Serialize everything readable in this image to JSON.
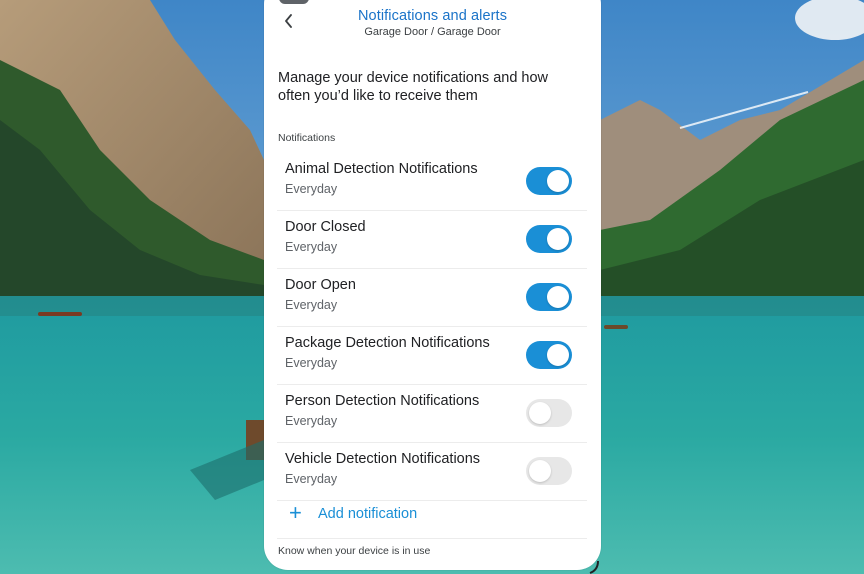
{
  "header": {
    "title": "Notifications and alerts",
    "subtitle": "Garage Door / Garage Door",
    "back_icon": "chevron-left-icon"
  },
  "intro": "Manage your device notifications and how often you’d like to receive them",
  "section_label": "Notifications",
  "notifications": [
    {
      "title": "Animal Detection Notifications",
      "frequency": "Everyday",
      "enabled": true
    },
    {
      "title": "Door Closed",
      "frequency": "Everyday",
      "enabled": true
    },
    {
      "title": "Door Open",
      "frequency": "Everyday",
      "enabled": true
    },
    {
      "title": "Package Detection Notifications",
      "frequency": "Everyday",
      "enabled": true
    },
    {
      "title": "Person Detection Notifications",
      "frequency": "Everyday",
      "enabled": false
    },
    {
      "title": "Vehicle Detection Notifications",
      "frequency": "Everyday",
      "enabled": false
    }
  ],
  "add_notification": {
    "label": "Add notification",
    "icon": "plus-icon"
  },
  "footer_note": "Know when your device is in use",
  "colors": {
    "accent": "#1a8fd6",
    "title_blue": "#1a73c8",
    "toggle_off": "#e7e7e7"
  }
}
